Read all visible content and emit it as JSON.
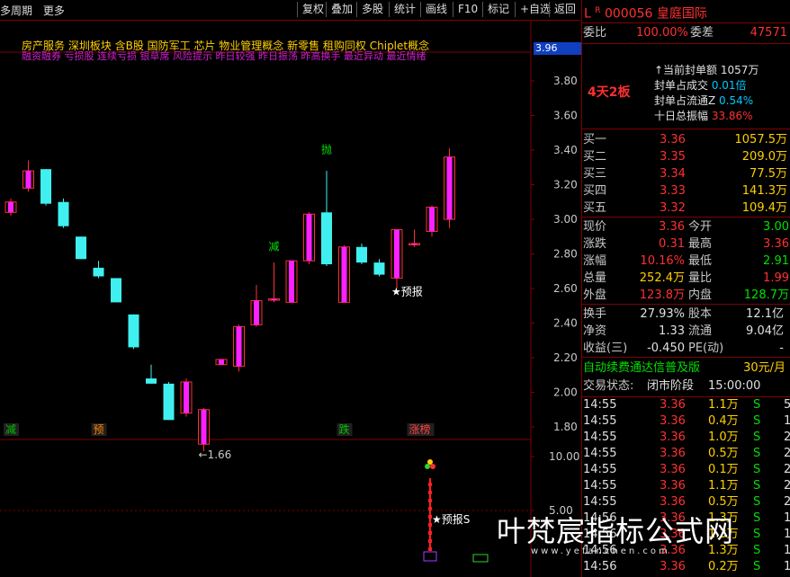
{
  "toolbar": {
    "left": [
      "多周期",
      "更多"
    ],
    "buttons": [
      "复权",
      "叠加",
      "多股",
      "统计",
      "画线",
      "F10",
      "标记",
      "+自选",
      "返回"
    ]
  },
  "concepts": {
    "line1": "房产服务  深圳板块  含B股 国防军工 芯片 物业管理概念 新零售 租购同权 Chiplet概念",
    "line2": "融资融券 亏损股 连续亏损 银草席 风险提示 昨日较强 昨日振荡 昨高换手 最近异动 最近情绪"
  },
  "current_price_tag": "3.96",
  "chart_data": {
    "type": "candlestick",
    "y_ticks": [
      "3.80",
      "3.60",
      "3.40",
      "3.20",
      "3.00",
      "2.80",
      "2.60",
      "2.40",
      "2.20",
      "2.00",
      "1.80"
    ],
    "sub_y_ticks": [
      "10.00",
      "5.00"
    ],
    "candles": [
      {
        "o": 3.04,
        "h": 3.12,
        "l": 3.02,
        "c": 3.1
      },
      {
        "o": 3.18,
        "h": 3.34,
        "l": 3.16,
        "c": 3.28
      },
      {
        "o": 3.29,
        "h": 3.29,
        "l": 3.08,
        "c": 3.09
      },
      {
        "o": 3.1,
        "h": 3.12,
        "l": 2.95,
        "c": 2.96
      },
      {
        "o": 2.9,
        "h": 2.9,
        "l": 2.77,
        "c": 2.77
      },
      {
        "o": 2.72,
        "h": 2.76,
        "l": 2.66,
        "c": 2.67
      },
      {
        "o": 2.66,
        "h": 2.66,
        "l": 2.52,
        "c": 2.52
      },
      {
        "o": 2.45,
        "h": 2.45,
        "l": 2.25,
        "c": 2.26
      },
      {
        "o": 2.08,
        "h": 2.16,
        "l": 2.05,
        "c": 2.05
      },
      {
        "o": 2.05,
        "h": 2.06,
        "l": 1.84,
        "c": 1.84
      },
      {
        "o": 1.88,
        "h": 2.08,
        "l": 1.86,
        "c": 2.06
      },
      {
        "o": 1.7,
        "h": 1.91,
        "l": 1.66,
        "c": 1.9
      },
      {
        "o": 2.16,
        "h": 2.19,
        "l": 2.16,
        "c": 2.19
      },
      {
        "o": 2.15,
        "h": 2.39,
        "l": 2.12,
        "c": 2.38
      },
      {
        "o": 2.39,
        "h": 2.62,
        "l": 2.38,
        "c": 2.53
      },
      {
        "o": 2.54,
        "h": 2.75,
        "l": 2.52,
        "c": 2.54
      },
      {
        "o": 2.52,
        "h": 2.76,
        "l": 2.52,
        "c": 2.76
      },
      {
        "o": 2.76,
        "h": 3.04,
        "l": 2.74,
        "c": 3.03
      },
      {
        "o": 3.04,
        "h": 3.28,
        "l": 2.73,
        "c": 2.74
      },
      {
        "o": 2.52,
        "h": 2.85,
        "l": 2.52,
        "c": 2.84
      },
      {
        "o": 2.84,
        "h": 2.86,
        "l": 2.74,
        "c": 2.75
      },
      {
        "o": 2.75,
        "h": 2.77,
        "l": 2.67,
        "c": 2.68
      },
      {
        "o": 2.66,
        "h": 2.94,
        "l": 2.6,
        "c": 2.94
      },
      {
        "o": 2.86,
        "h": 2.94,
        "l": 2.84,
        "c": 2.86
      },
      {
        "o": 2.93,
        "h": 3.08,
        "l": 2.9,
        "c": 3.07
      },
      {
        "o": 3.0,
        "h": 3.41,
        "l": 2.95,
        "c": 3.36
      }
    ],
    "annotations": [
      {
        "text": "抛",
        "i": 18,
        "price": 3.36
      },
      {
        "text": "减",
        "i": 15,
        "price": 2.8
      },
      {
        "text": "★预报",
        "i": 22,
        "price": 2.54
      },
      {
        "text": "←1.66",
        "i": 11,
        "price": 1.66
      }
    ],
    "signal_labels": [
      {
        "text": "减",
        "i": 0,
        "color": "#00c000"
      },
      {
        "text": "预",
        "i": 5,
        "color": "#ff8000"
      },
      {
        "text": "跌",
        "i": 19,
        "color": "#00c000"
      },
      {
        "text": "涨榜",
        "i": 23,
        "color": "#ff4040"
      }
    ],
    "sub_annotation": "★预报S"
  },
  "right_panel": {
    "stock_letter": "L",
    "stock_r": "R",
    "code": "000056",
    "name": "皇庭国际",
    "weibi_label": "委比",
    "weibi_value": "100.00%",
    "weicha_label": "委差",
    "weicha_value": "47571",
    "board_tag": "4天2板",
    "seal_items": [
      {
        "label": "当前封单额",
        "value": "1057万"
      },
      {
        "label": "封单占成交",
        "value": "0.01倍"
      },
      {
        "label": "封单占流通Z",
        "value": "0.54%"
      },
      {
        "label": "十日总振幅",
        "value": "33.86%"
      }
    ],
    "bids": [
      {
        "label": "买一",
        "price": "3.36",
        "vol": "1057.5万"
      },
      {
        "label": "买二",
        "price": "3.35",
        "vol": "209.0万"
      },
      {
        "label": "买三",
        "price": "3.34",
        "vol": "77.5万"
      },
      {
        "label": "买四",
        "price": "3.33",
        "vol": "141.3万"
      },
      {
        "label": "买五",
        "price": "3.32",
        "vol": "109.4万"
      }
    ],
    "quote": [
      {
        "l1": "现价",
        "v1": "3.36",
        "l2": "今开",
        "v2": "3.00"
      },
      {
        "l1": "涨跌",
        "v1": "0.31",
        "l2": "最高",
        "v2": "3.36"
      },
      {
        "l1": "涨幅",
        "v1": "10.16%",
        "l2": "最低",
        "v2": "2.91"
      },
      {
        "l1": "总量",
        "v1": "252.4万",
        "l2": "量比",
        "v2": "1.99"
      },
      {
        "l1": "外盘",
        "v1": "123.8万",
        "l2": "内盘",
        "v2": "128.7万"
      }
    ],
    "fund": [
      {
        "l1": "换手",
        "v1": "27.93%",
        "l2": "股本",
        "v2": "12.1亿"
      },
      {
        "l1": "净资",
        "v1": "1.33",
        "l2": "流通",
        "v2": "9.04亿"
      },
      {
        "l1": "收益(三)",
        "v1": "-0.450",
        "l2": "PE(动)",
        "v2": "-"
      }
    ],
    "service_text": "自动续费通达信普及版",
    "service_price": "30元/月",
    "trade_status_label": "交易状态:",
    "trade_status_value": "闭市阶段",
    "trade_status_time": "15:00:00",
    "ticks": [
      {
        "t": "14:55",
        "p": "3.36",
        "v": "1.1万",
        "d": "S",
        "n": "5"
      },
      {
        "t": "14:55",
        "p": "3.36",
        "v": "0.4万",
        "d": "S",
        "n": "1"
      },
      {
        "t": "14:55",
        "p": "3.36",
        "v": "1.0万",
        "d": "S",
        "n": "2"
      },
      {
        "t": "14:55",
        "p": "3.36",
        "v": "0.5万",
        "d": "S",
        "n": "2"
      },
      {
        "t": "14:55",
        "p": "3.36",
        "v": "0.1万",
        "d": "S",
        "n": "2"
      },
      {
        "t": "14:55",
        "p": "3.36",
        "v": "1.1万",
        "d": "S",
        "n": "2"
      },
      {
        "t": "14:55",
        "p": "3.36",
        "v": "0.5万",
        "d": "S",
        "n": "2"
      },
      {
        "t": "14:56",
        "p": "3.36",
        "v": "1.3万",
        "d": "S",
        "n": "1"
      },
      {
        "t": "14:56",
        "p": "3.36",
        "v": "1.3万",
        "d": "S",
        "n": "1"
      },
      {
        "t": "14:56",
        "p": "3.36",
        "v": "1.3万",
        "d": "S",
        "n": "1"
      },
      {
        "t": "14:56",
        "p": "3.36",
        "v": "0.2万",
        "d": "S",
        "n": "1"
      }
    ]
  },
  "watermark": {
    "title": "叶梵宸指标公式网",
    "url": "www.yefanchen.com"
  },
  "colors": {
    "up": "#ff20ff",
    "down": "#40f0f0",
    "frame": "#800000",
    "accent_red": "#ff3030"
  }
}
